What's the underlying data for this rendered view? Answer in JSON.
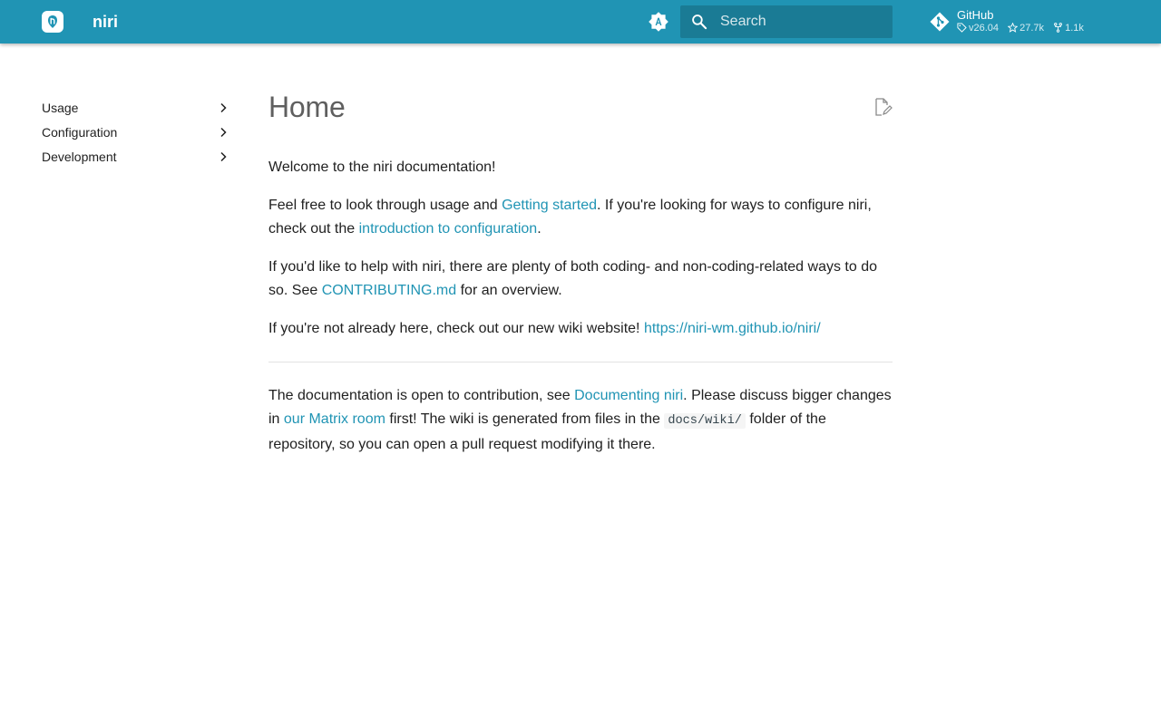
{
  "header": {
    "site_name": "niri",
    "search_placeholder": "Search",
    "repo": {
      "name": "GitHub",
      "version": "v26.04",
      "stars": "27.7k",
      "forks": "1.1k"
    },
    "icons": {
      "logo": "niri-logo-icon",
      "palette": "brightness-auto-icon",
      "search": "search-icon",
      "repo": "git-icon"
    }
  },
  "nav": {
    "items": [
      {
        "label": "Usage"
      },
      {
        "label": "Configuration"
      },
      {
        "label": "Development"
      }
    ]
  },
  "content": {
    "title": "Home",
    "p1": "Welcome to the niri documentation!",
    "p2": {
      "t1": "Feel free to look through usage and ",
      "link1": "Getting started",
      "t2": ". If you're looking for ways to configure niri, check out the ",
      "link2": "introduction to configuration",
      "t3": "."
    },
    "p3": {
      "t1": "If you'd like to help with niri, there are plenty of both coding- and non-coding-related ways to do so. See ",
      "link1": "CONTRIBUTING.md",
      "t2": " for an overview."
    },
    "p4": {
      "t1": "If you're not already here, check out our new wiki website! ",
      "link1": "https://niri-wm.github.io/niri/"
    },
    "p5": {
      "t1": "The documentation is open to contribution, see ",
      "link1": "Documenting niri",
      "t2": ". Please discuss bigger changes in ",
      "link2": "our Matrix room",
      "t3": " first! The wiki is generated from files in the ",
      "code1": "docs/wiki/",
      "t4": " folder of the repository, so you can open a pull request modifying it there."
    }
  },
  "colors": {
    "header": "#2094b4",
    "search_bg": "#1a7b95",
    "link": "#2094b4",
    "text": "#212121",
    "title": "#5f5f5f"
  }
}
